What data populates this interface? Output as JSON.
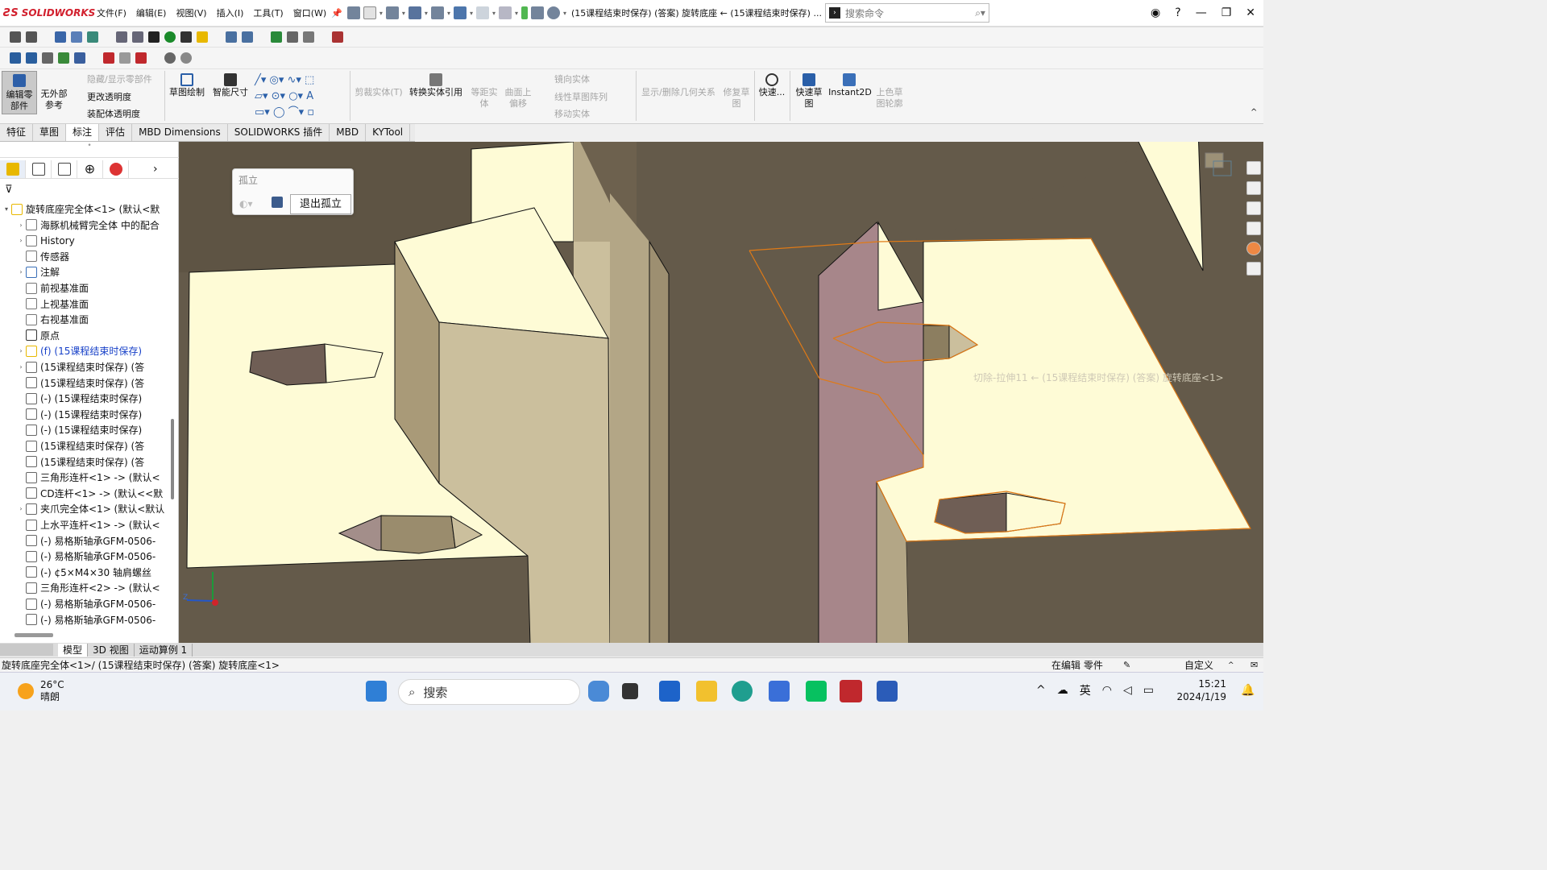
{
  "app": {
    "brand": "SOLIDWORKS",
    "document_title": "(15课程结束时保存)  (答案) 旋转底座 ← (15课程结束时保存) ..."
  },
  "menu": [
    "文件(F)",
    "编辑(E)",
    "视图(V)",
    "插入(I)",
    "工具(T)",
    "窗口(W)"
  ],
  "search": {
    "placeholder": "搜索命令"
  },
  "command_manager": {
    "edit_part": "编辑零\n部件",
    "no_external_ref": "无外部\n参考",
    "hide_show_parts": "隐藏/显示零部件",
    "change_transparency": "更改透明度",
    "assembly_transparency": "装配体透明度",
    "sketch": "草图绘制",
    "smart_dimension": "智能尺寸",
    "trim_entities": "剪裁实体(T)",
    "convert_entities": "转换实体引用",
    "offset_entities": "等距实\n体",
    "offset_on_surface": "曲面上\n偏移",
    "mirror_entities": "镜向实体",
    "linear_pattern": "线性草图阵列",
    "move_entities": "移动实体",
    "display_relations": "显示/删除几何关系",
    "repair_sketch": "修复草\n图",
    "quick_snaps": "快速...",
    "rapid_sketch": "快速草\n图",
    "instant2d": "Instant2D",
    "shaded_sketch": "上色草\n图轮廓"
  },
  "tabs": [
    "特征",
    "草图",
    "标注",
    "评估",
    "MBD Dimensions",
    "SOLIDWORKS 插件",
    "MBD",
    "KYTool"
  ],
  "active_tab": "标注",
  "tree": {
    "nodes": [
      {
        "label": "旋转底座完全体<1> (默认<默",
        "exp": "▾"
      },
      {
        "label": "海豚机械臂完全体 中的配合",
        "exp": "›"
      },
      {
        "label": "History",
        "exp": "›"
      },
      {
        "label": "传感器",
        "exp": ""
      },
      {
        "label": "注解",
        "exp": "›"
      },
      {
        "label": "前视基准面",
        "exp": ""
      },
      {
        "label": "上视基准面",
        "exp": ""
      },
      {
        "label": "右视基准面",
        "exp": ""
      },
      {
        "label": "原点",
        "exp": ""
      },
      {
        "label": "(f)  (15课程结束时保存)",
        "exp": "›",
        "blue": true
      },
      {
        "label": "  (15课程结束时保存)   (答",
        "exp": "›"
      },
      {
        "label": "  (15课程结束时保存)   (答",
        "exp": ""
      },
      {
        "label": "(-)  (15课程结束时保存) ",
        "exp": ""
      },
      {
        "label": "(-)  (15课程结束时保存)",
        "exp": ""
      },
      {
        "label": "(-)  (15课程结束时保存)",
        "exp": ""
      },
      {
        "label": "  (15课程结束时保存)   (答",
        "exp": ""
      },
      {
        "label": "  (15课程结束时保存)   (答",
        "exp": ""
      },
      {
        "label": "三角形连杆<1> -> (默认<",
        "exp": ""
      },
      {
        "label": "CD连杆<1> -> (默认<<默",
        "exp": ""
      },
      {
        "label": "夹爪完全体<1> (默认<默认",
        "exp": "›"
      },
      {
        "label": "上水平连杆<1> -> (默认<",
        "exp": ""
      },
      {
        "label": "(-) 易格斯轴承GFM-0506-",
        "exp": ""
      },
      {
        "label": "(-) 易格斯轴承GFM-0506-",
        "exp": ""
      },
      {
        "label": "(-) ¢5×M4×30 轴肩螺丝",
        "exp": ""
      },
      {
        "label": "三角形连杆<2> -> (默认<",
        "exp": ""
      },
      {
        "label": "(-) 易格斯轴承GFM-0506-",
        "exp": ""
      },
      {
        "label": "(-) 易格斯轴承GFM-0506-",
        "exp": ""
      }
    ]
  },
  "isolate": {
    "title": "孤立",
    "exit": "退出孤立"
  },
  "tooltip": "切除-拉伸11 ← (15课程结束时保存)  (答案) 旋转底座<1>",
  "triad": {
    "z": "Z"
  },
  "bottom_tabs": [
    "模型",
    "3D 视图",
    "运动算例 1"
  ],
  "status": {
    "path": "旋转底座完全体<1>/ (15课程结束时保存)  (答案) 旋转底座<1>",
    "mode": "在编辑 零件",
    "units": "自定义"
  },
  "taskbar": {
    "temp": "26°C",
    "weather": "晴朗",
    "search": "搜索",
    "lang": "英",
    "time": "15:21",
    "date": "2024/1/19"
  }
}
